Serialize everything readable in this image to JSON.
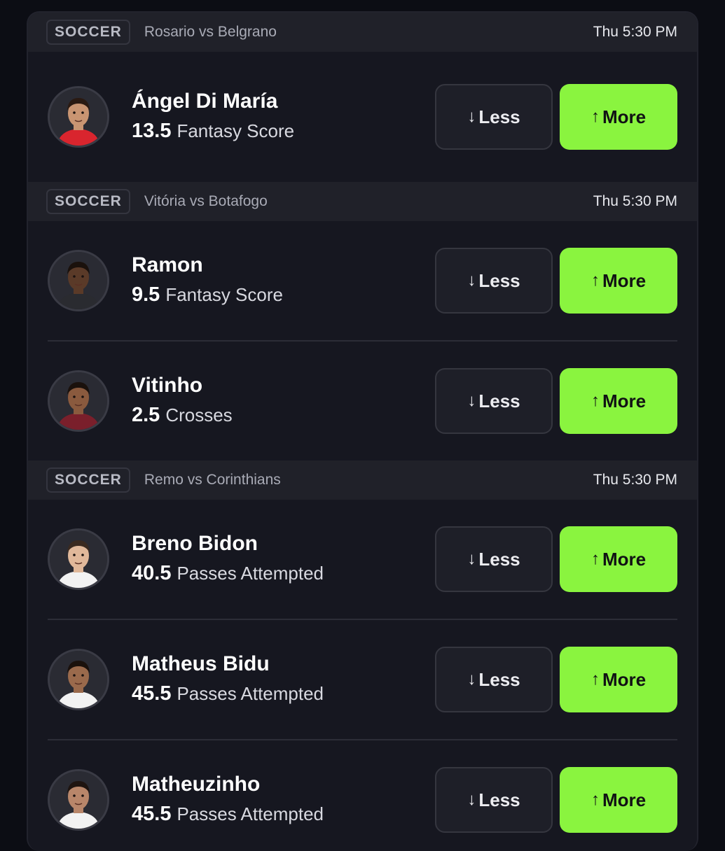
{
  "games": [
    {
      "sport": "SOCCER",
      "matchup": "Rosario vs Belgrano",
      "time": "Thu 5:30 PM",
      "players": [
        {
          "name": "Ángel Di María",
          "line": "13.5",
          "stat": "Fantasy Score",
          "jersey": "#d9252e",
          "skin": "#c99572",
          "hair": "#2a1a12"
        }
      ]
    },
    {
      "sport": "SOCCER",
      "matchup": "Vitória vs Botafogo",
      "time": "Thu 5:30 PM",
      "players": [
        {
          "name": "Ramon",
          "line": "9.5",
          "stat": "Fantasy Score",
          "jersey": "#2a2b30",
          "skin": "#5a3a28",
          "hair": "#1a110c"
        },
        {
          "name": "Vitinho",
          "line": "2.5",
          "stat": "Crosses",
          "jersey": "#7a1f2b",
          "skin": "#8a5a3e",
          "hair": "#1a110c"
        }
      ]
    },
    {
      "sport": "SOCCER",
      "matchup": "Remo vs Corinthians",
      "time": "Thu 5:30 PM",
      "players": [
        {
          "name": "Breno Bidon",
          "line": "40.5",
          "stat": "Passes Attempted",
          "jersey": "#f2f2f2",
          "skin": "#e0b89a",
          "hair": "#3a2a20"
        },
        {
          "name": "Matheus Bidu",
          "line": "45.5",
          "stat": "Passes Attempted",
          "jersey": "#f2f2f2",
          "skin": "#9a6a4c",
          "hair": "#1a110c"
        },
        {
          "name": "Matheuzinho",
          "line": "45.5",
          "stat": "Passes Attempted",
          "jersey": "#f2f2f2",
          "skin": "#b8866a",
          "hair": "#1e1410"
        }
      ]
    }
  ],
  "buttons": {
    "less_label": "Less",
    "more_label": "More",
    "less_icon": "arrow-down-icon",
    "more_icon": "arrow-up-icon"
  },
  "colors": {
    "more_accent": "#8af43f",
    "background": "#161720"
  }
}
